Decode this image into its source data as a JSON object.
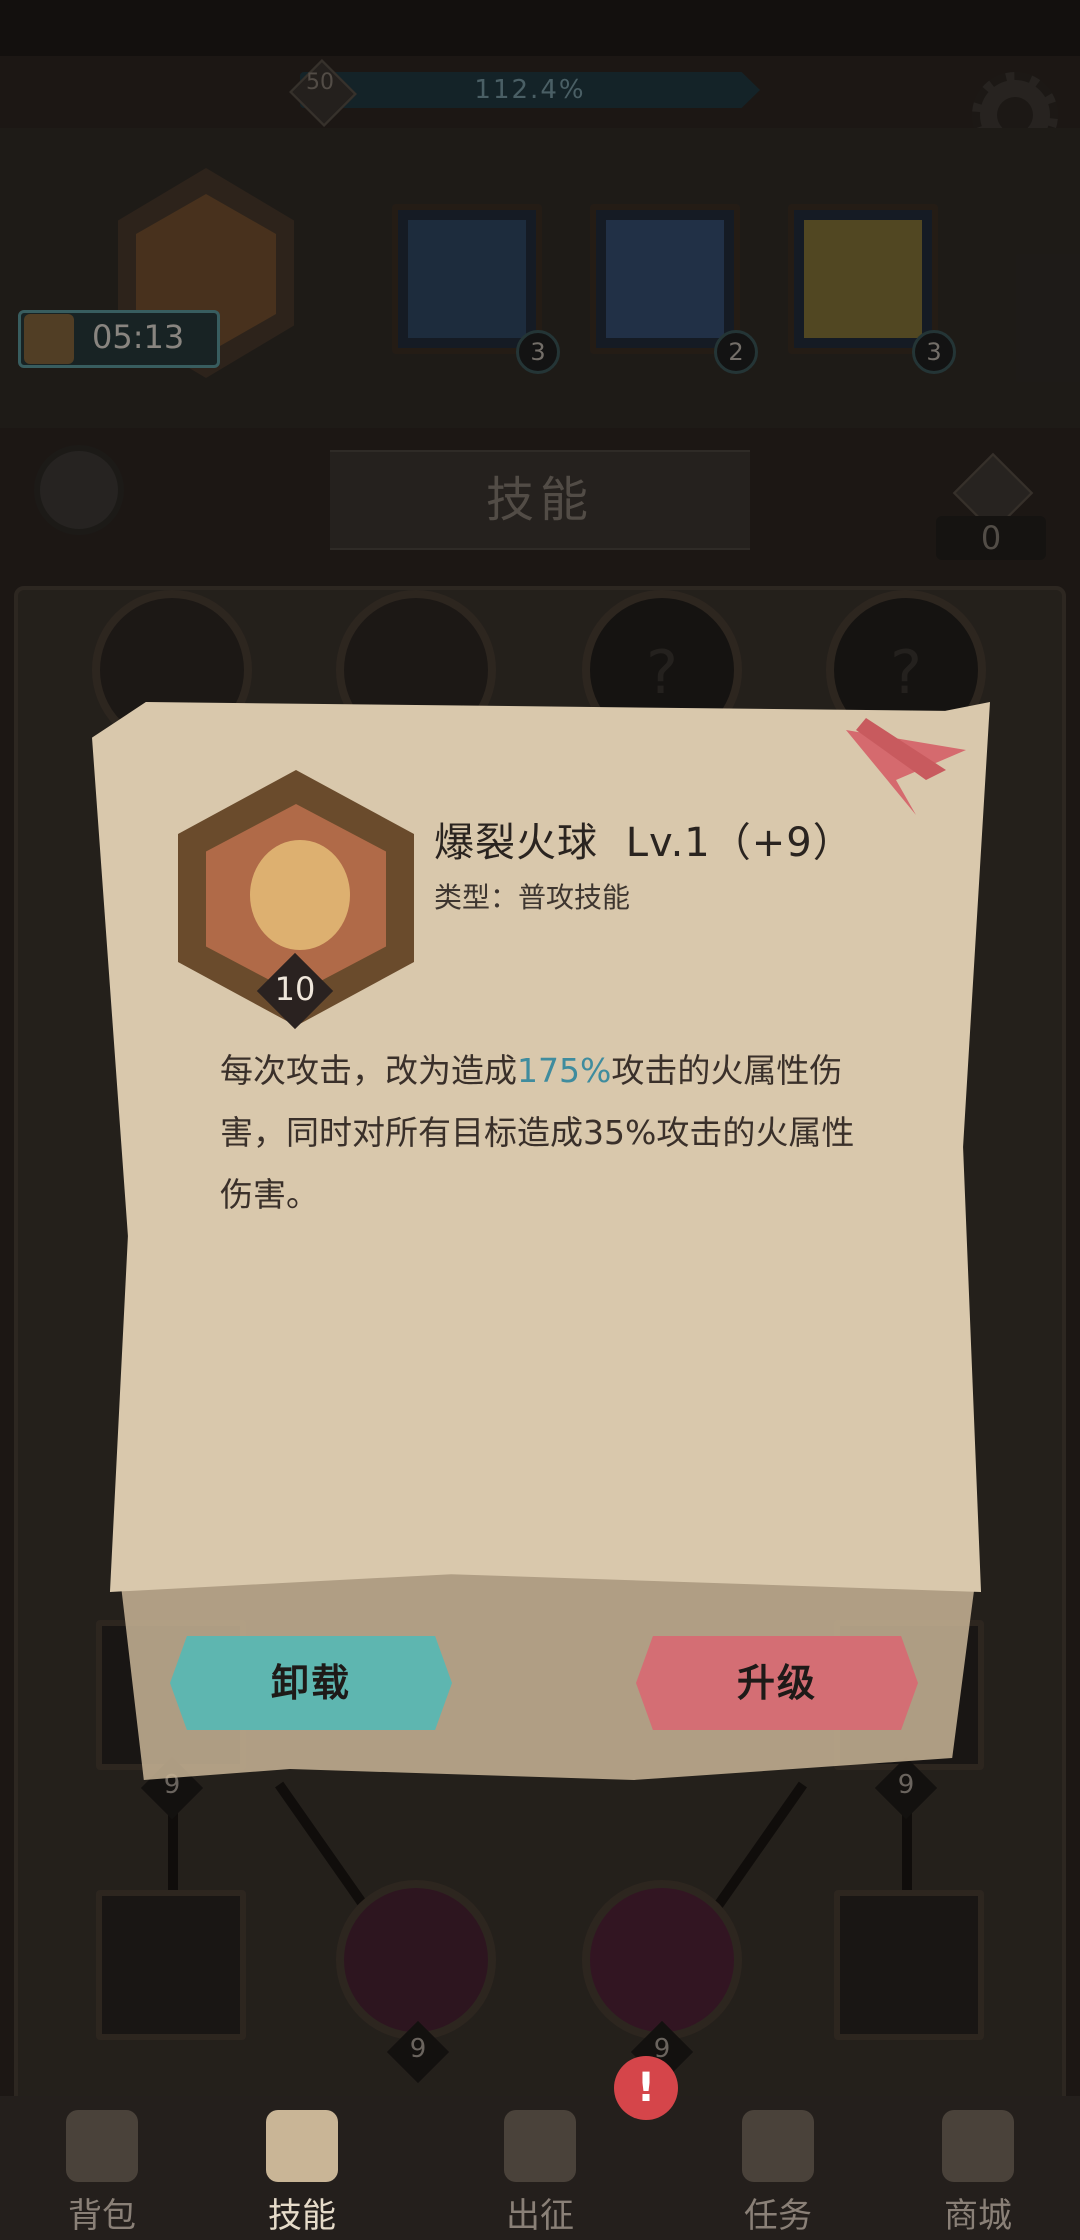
{
  "top": {
    "level": "50",
    "progress_text": "112.4%",
    "timer": "05:13"
  },
  "equipped_slots": [
    {
      "badge": "3"
    },
    {
      "badge": "2"
    },
    {
      "badge": "3"
    }
  ],
  "skills_header": {
    "title": "技能",
    "token_count": "0"
  },
  "tree_levels": {
    "left": "9",
    "right": "9",
    "bottom_mid_left": "9",
    "bottom_mid_right": "9"
  },
  "skill_popup": {
    "name": "爆裂火球",
    "level": "Lv.1（+9）",
    "type_label": "类型：普攻技能",
    "icon_level": "10",
    "desc_part1": "每次攻击，改为造成",
    "desc_highlight": "175%",
    "desc_part2": "攻击的火属性伤害，同时对所有目标造成35%攻击的火属性伤害。",
    "highlight_color": "#3f8c9e",
    "unload_label": "卸载",
    "upgrade_label": "升级"
  },
  "nav": {
    "tabs": [
      {
        "label": "背包",
        "icon": "backpack-icon"
      },
      {
        "label": "技能",
        "icon": "skill-book-icon"
      },
      {
        "label": "出征",
        "icon": "sword-map-icon"
      },
      {
        "label": "任务",
        "icon": "scroll-icon"
      },
      {
        "label": "商城",
        "icon": "shop-icon"
      }
    ],
    "active": "技能",
    "alert": "!"
  }
}
